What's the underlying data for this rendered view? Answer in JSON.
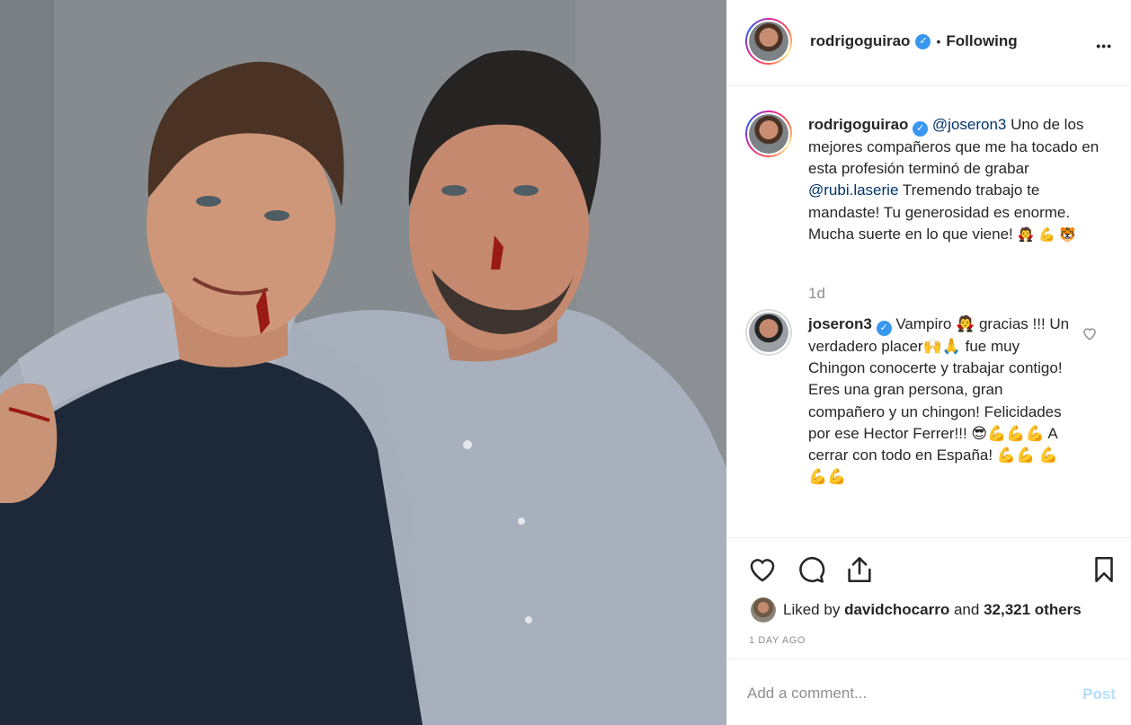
{
  "post": {
    "author": "rodrigoguirao",
    "follow_sep": "•",
    "follow_state": "Following",
    "more": "•••"
  },
  "caption": {
    "username": "rodrigoguirao",
    "mention1": "@joseron3",
    "text1": "Uno de los mejores compañeros que me ha tocado en esta profesión terminó de grabar",
    "mention2": "@rubi.laserie",
    "text2": "Tremendo trabajo te mandaste! Tu generosidad es enorme. Mucha suerte en lo que viene!",
    "emoji": "🧛 💪 🐯",
    "time": "1d"
  },
  "reply": {
    "username": "joseron3",
    "text": "Vampiro 🧛 gracias !!! Un verdadero placer🙌🙏 fue muy Chingon conocerte y trabajar contigo! Eres una gran persona, gran compañero y un chingon! Felicidades por ese Hector Ferrer!!! 😎💪💪💪 A cerrar con todo en España! 💪💪 💪💪💪"
  },
  "likes": {
    "prefix": "Liked by",
    "user": "davidchocarro",
    "and": "and",
    "others": "32,321 others"
  },
  "timestamp": "1 DAY AGO",
  "comment_box": {
    "placeholder": "Add a comment...",
    "post_label": "Post"
  },
  "colors": {
    "verified": "#3897f0",
    "mention": "#003569",
    "post_disabled": "#b2dffc"
  }
}
